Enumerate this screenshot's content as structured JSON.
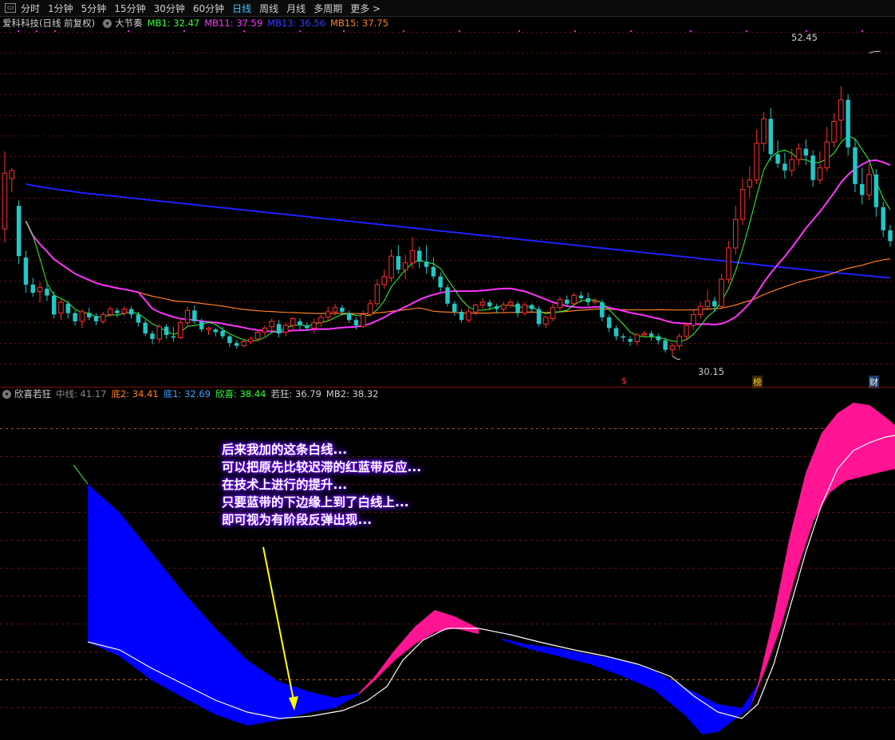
{
  "toolbar": {
    "items": [
      "分时",
      "1分钟",
      "5分钟",
      "15分钟",
      "30分钟",
      "60分钟",
      "日线",
      "周线",
      "月线",
      "多周期",
      "更多 >"
    ],
    "active_index": 6
  },
  "main_legend": {
    "stock_name": "爱科科技(日线 前复权)",
    "indicator": "大节奏",
    "mb1": "MB1: 32.47",
    "mb11": "MB11: 37.59",
    "mb13": "MB13: 36.56",
    "mb15": "MB15: 37.75"
  },
  "sub_legend": {
    "indicator": "欣喜若狂",
    "mid": "中线: 41.17",
    "di2": "底2: 34.41",
    "di1": "底1: 32.69",
    "xinxi": "欣喜: 38.44",
    "ruokuang": "若狂: 36.79",
    "mb2": "MB2: 38.32"
  },
  "colors": {
    "up": "#ff3030",
    "down": "#20c8c8",
    "mb1": "#33ff33",
    "mb11": "#ff33ff",
    "mb13": "#2020ff",
    "mb15": "#ff8020",
    "band_blue": "#0000ff",
    "band_pink": "#ff1493",
    "white_line": "#ffffff",
    "arrow": "#ffff00",
    "annotation_glow": "#6a00ff"
  },
  "labels": {
    "high_price": "52.45",
    "low_price": "30.15",
    "marker_s": "$",
    "marker_bang": "榜",
    "marker_cai": "财"
  },
  "annotation": {
    "lines": [
      "后来我加的这条白线...",
      "可以把原先比较迟滞的红蓝带反应...",
      "在技术上进行的提升...",
      "只要蓝带的下边缘上到了白线上...",
      "即可视为有阶段反弹出现..."
    ]
  },
  "chart_data": {
    "type": "candlestick",
    "price_range": [
      29,
      54
    ],
    "high": 52.45,
    "low": 30.15,
    "candles": [
      [
        39.5,
        43.6,
        38.5,
        45.2
      ],
      [
        43.2,
        43.8,
        42.2,
        44.0
      ],
      [
        41.2,
        37.5,
        36.9,
        41.6
      ],
      [
        37.4,
        35.4,
        34.8,
        37.9
      ],
      [
        35.4,
        34.8,
        34.5,
        35.9
      ],
      [
        34.9,
        35.2,
        34.1,
        35.6
      ],
      [
        35.1,
        34.6,
        34.2,
        35.4
      ],
      [
        34.6,
        33.2,
        32.9,
        34.9
      ],
      [
        33.3,
        34.1,
        32.8,
        34.3
      ],
      [
        34.0,
        33.3,
        32.9,
        34.2
      ],
      [
        33.3,
        32.7,
        32.4,
        33.5
      ],
      [
        32.7,
        33.4,
        32.2,
        33.6
      ],
      [
        33.3,
        33.0,
        32.8,
        33.7
      ],
      [
        33.1,
        32.7,
        32.4,
        33.3
      ],
      [
        32.7,
        33.2,
        32.5,
        33.4
      ],
      [
        33.2,
        33.6,
        33.0,
        33.8
      ],
      [
        33.5,
        33.3,
        33.0,
        33.7
      ],
      [
        33.3,
        33.6,
        33.1,
        33.8
      ],
      [
        33.6,
        33.2,
        32.9,
        33.8
      ],
      [
        33.2,
        32.6,
        32.3,
        33.4
      ],
      [
        32.6,
        31.8,
        31.6,
        32.8
      ],
      [
        31.8,
        31.4,
        31.0,
        32.0
      ],
      [
        31.4,
        32.3,
        31.1,
        32.5
      ],
      [
        32.3,
        31.7,
        31.4,
        32.5
      ],
      [
        31.6,
        31.5,
        31.2,
        32.3
      ],
      [
        31.5,
        32.6,
        31.4,
        32.8
      ],
      [
        32.6,
        33.5,
        32.3,
        33.8
      ],
      [
        33.5,
        32.7,
        32.5,
        33.9
      ],
      [
        32.7,
        32.1,
        31.9,
        32.9
      ],
      [
        32.1,
        32.2,
        31.7,
        32.3
      ],
      [
        32.1,
        31.9,
        31.6,
        32.2
      ],
      [
        32.0,
        31.6,
        31.4,
        32.3
      ],
      [
        31.6,
        31.1,
        30.8,
        31.7
      ],
      [
        31.1,
        30.9,
        30.7,
        31.3
      ],
      [
        30.9,
        31.2,
        30.8,
        31.4
      ],
      [
        31.2,
        31.4,
        31.0,
        31.6
      ],
      [
        31.4,
        31.9,
        31.2,
        32.1
      ],
      [
        31.9,
        32.2,
        31.6,
        32.4
      ],
      [
        32.3,
        32.7,
        32.0,
        32.9
      ],
      [
        32.5,
        31.8,
        31.5,
        32.8
      ],
      [
        31.9,
        32.4,
        31.6,
        32.6
      ],
      [
        32.4,
        32.9,
        32.0,
        33.0
      ],
      [
        32.7,
        32.4,
        32.1,
        32.9
      ],
      [
        32.4,
        32.2,
        32.0,
        32.6
      ],
      [
        32.2,
        32.6,
        31.8,
        32.9
      ],
      [
        32.6,
        33.0,
        32.3,
        33.2
      ],
      [
        33.0,
        33.4,
        32.7,
        33.8
      ],
      [
        33.4,
        33.7,
        33.1,
        34.0
      ],
      [
        33.7,
        33.4,
        33.1,
        33.9
      ],
      [
        33.3,
        32.8,
        32.6,
        33.5
      ],
      [
        32.8,
        32.4,
        32.1,
        33.0
      ],
      [
        32.3,
        33.2,
        32.2,
        33.5
      ],
      [
        33.2,
        34.0,
        33.0,
        34.3
      ],
      [
        34.0,
        35.4,
        33.8,
        35.8
      ],
      [
        35.4,
        36.0,
        35.1,
        36.5
      ],
      [
        35.9,
        37.5,
        35.6,
        38.0
      ],
      [
        37.5,
        36.5,
        36.2,
        38.3
      ],
      [
        36.5,
        37.0,
        35.8,
        37.6
      ],
      [
        37.0,
        37.9,
        36.6,
        38.9
      ],
      [
        37.9,
        37.1,
        36.6,
        38.2
      ],
      [
        37.1,
        36.7,
        36.2,
        38.3
      ],
      [
        36.7,
        36.0,
        35.8,
        37.4
      ],
      [
        36.0,
        35.2,
        34.9,
        36.3
      ],
      [
        35.2,
        34.0,
        33.8,
        35.4
      ],
      [
        34.0,
        33.4,
        33.1,
        34.2
      ],
      [
        33.4,
        32.8,
        32.6,
        33.6
      ],
      [
        32.8,
        33.4,
        32.6,
        33.7
      ],
      [
        33.4,
        33.9,
        33.1,
        34.0
      ],
      [
        33.9,
        34.1,
        33.6,
        34.4
      ],
      [
        34.1,
        33.8,
        33.5,
        34.3
      ],
      [
        33.8,
        33.6,
        33.3,
        34.0
      ],
      [
        33.6,
        33.9,
        33.4,
        34.1
      ],
      [
        33.9,
        34.1,
        33.7,
        34.3
      ],
      [
        34.0,
        33.3,
        33.0,
        34.2
      ],
      [
        33.3,
        33.9,
        33.1,
        34.1
      ],
      [
        33.9,
        33.6,
        33.3,
        34.0
      ],
      [
        33.6,
        32.5,
        32.3,
        33.8
      ],
      [
        32.5,
        33.0,
        32.2,
        33.1
      ],
      [
        32.9,
        33.7,
        32.7,
        34.0
      ],
      [
        33.7,
        34.3,
        33.5,
        34.5
      ],
      [
        34.3,
        34.0,
        33.8,
        34.6
      ],
      [
        34.0,
        34.6,
        33.8,
        34.8
      ],
      [
        34.6,
        34.4,
        34.1,
        34.9
      ],
      [
        34.4,
        34.1,
        33.8,
        34.8
      ],
      [
        34.1,
        34.2,
        33.9,
        34.4
      ],
      [
        34.1,
        33.0,
        32.7,
        34.3
      ],
      [
        33.0,
        32.2,
        31.9,
        33.2
      ],
      [
        32.2,
        31.6,
        31.3,
        32.4
      ],
      [
        31.6,
        31.5,
        31.2,
        31.8
      ],
      [
        31.4,
        31.2,
        30.9,
        31.6
      ],
      [
        31.2,
        31.7,
        30.9,
        31.9
      ],
      [
        31.7,
        31.8,
        31.5,
        32.0
      ],
      [
        31.8,
        31.6,
        31.3,
        32.0
      ],
      [
        31.6,
        31.3,
        31.0,
        31.8
      ],
      [
        31.3,
        30.6,
        30.4,
        31.5
      ],
      [
        30.6,
        30.9,
        30.15,
        31.1
      ],
      [
        30.9,
        31.6,
        30.6,
        31.8
      ],
      [
        31.6,
        32.4,
        31.3,
        32.6
      ],
      [
        32.4,
        33.2,
        32.1,
        33.5
      ],
      [
        33.2,
        33.8,
        32.9,
        34.1
      ],
      [
        33.8,
        34.2,
        33.5,
        35.0
      ],
      [
        34.2,
        33.8,
        33.4,
        34.5
      ],
      [
        33.8,
        35.8,
        33.6,
        36.2
      ],
      [
        35.8,
        38.1,
        35.5,
        38.6
      ],
      [
        38.1,
        40.2,
        37.6,
        41.2
      ],
      [
        40.2,
        42.4,
        39.8,
        43.2
      ],
      [
        42.6,
        43.1,
        41.8,
        44.1
      ],
      [
        43.1,
        45.8,
        42.8,
        46.8
      ],
      [
        45.8,
        47.6,
        45.2,
        48.1
      ],
      [
        47.6,
        45.0,
        44.5,
        48.4
      ],
      [
        45.0,
        44.3,
        44.0,
        46.0
      ],
      [
        44.3,
        43.8,
        43.2,
        45.1
      ],
      [
        43.8,
        44.6,
        43.4,
        45.4
      ],
      [
        44.6,
        45.4,
        44.2,
        45.8
      ],
      [
        45.4,
        44.9,
        44.2,
        46.1
      ],
      [
        44.9,
        43.1,
        42.6,
        45.3
      ],
      [
        43.1,
        44.0,
        42.8,
        45.2
      ],
      [
        44.0,
        45.9,
        43.7,
        47.0
      ],
      [
        45.9,
        47.4,
        45.5,
        48.0
      ],
      [
        47.5,
        49.0,
        46.0,
        50.0
      ],
      [
        49.0,
        45.5,
        44.9,
        49.4
      ],
      [
        45.5,
        42.8,
        42.2,
        46.1
      ],
      [
        42.8,
        42.0,
        41.3,
        44.0
      ],
      [
        42.0,
        43.5,
        41.6,
        44.3
      ],
      [
        43.5,
        41.1,
        40.4,
        43.9
      ],
      [
        41.1,
        39.4,
        38.9,
        41.5
      ],
      [
        39.4,
        38.6,
        38.2,
        39.8
      ]
    ],
    "high_index": 123,
    "low_index": 95,
    "series": [
      {
        "name": "MB1",
        "values_note": "short moving average"
      },
      {
        "name": "MB11"
      },
      {
        "name": "MB13"
      },
      {
        "name": "MB15"
      }
    ],
    "sub_chart": {
      "type": "band",
      "range": [
        0,
        100
      ]
    }
  }
}
